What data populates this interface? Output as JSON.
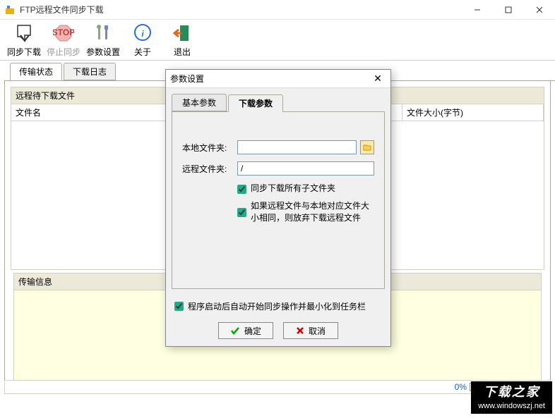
{
  "window": {
    "title": "FTP远程文件同步下载"
  },
  "toolbar": {
    "sync_download": "同步下载",
    "stop_sync": "停止同步",
    "settings": "参数设置",
    "about": "关于",
    "exit": "退出"
  },
  "main_tabs": {
    "transfer_status": "传输状态",
    "download_log": "下载日志"
  },
  "main": {
    "remote_pending_title": "远程待下载文件",
    "col_filename": "文件名",
    "col_filesize": "文件大小(字节)",
    "transfer_info_title": "传输信息"
  },
  "status": {
    "progress_pct": "0%"
  },
  "dialog": {
    "title": "参数设置",
    "tab_basic": "基本参数",
    "tab_download": "下载参数",
    "label_local_folder": "本地文件夹:",
    "value_local_folder": "",
    "label_remote_folder": "远程文件夹:",
    "value_remote_folder": "/",
    "chk_sync_subfolders": "同步下载所有子文件夹",
    "chk_skip_same_size": "如果远程文件与本地对应文件大小相同，则放弃下载远程文件",
    "chk_auto_start": "程序启动后自动开始同步操作并最小化到任务栏",
    "btn_ok": "确定",
    "btn_cancel": "取消"
  },
  "watermark": {
    "brand": "下载之家",
    "url": "www.windowszj.net"
  }
}
